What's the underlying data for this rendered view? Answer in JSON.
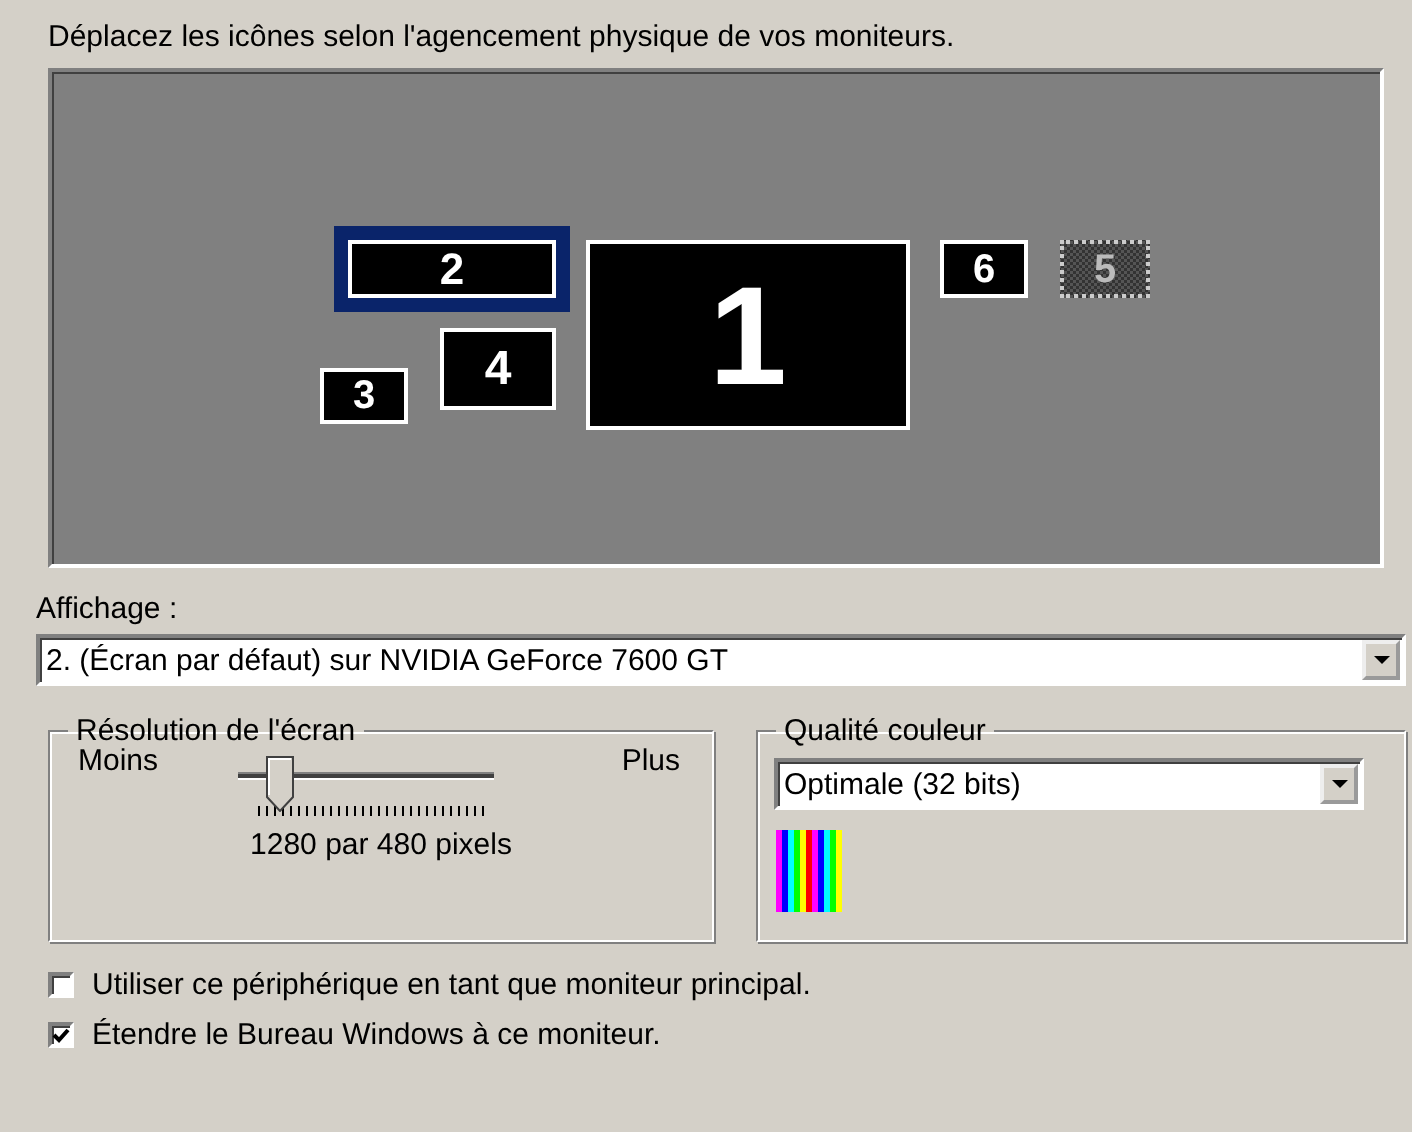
{
  "instruction": "Déplacez les icônes selon l'agencement physique de vos moniteurs.",
  "monitors": [
    {
      "number": "2",
      "selected": true,
      "disabled": false
    },
    {
      "number": "1",
      "selected": false,
      "disabled": false
    },
    {
      "number": "6",
      "selected": false,
      "disabled": false
    },
    {
      "number": "5",
      "selected": false,
      "disabled": true
    },
    {
      "number": "4",
      "selected": false,
      "disabled": false
    },
    {
      "number": "3",
      "selected": false,
      "disabled": false
    }
  ],
  "display": {
    "label": "Affichage :",
    "value": "2. (Écran par défaut) sur NVIDIA GeForce 7600 GT"
  },
  "resolution": {
    "title": "Résolution de l'écran",
    "min_label": "Moins",
    "max_label": "Plus",
    "level": 0.1,
    "reading": "1280 par 480 pixels"
  },
  "color_quality": {
    "title": "Qualité couleur",
    "value": "Optimale (32 bits)"
  },
  "checkboxes": [
    {
      "label": "Utiliser ce périphérique en tant que moniteur principal.",
      "checked": false
    },
    {
      "label": "Étendre le Bureau Windows à ce moniteur.",
      "checked": true
    }
  ]
}
